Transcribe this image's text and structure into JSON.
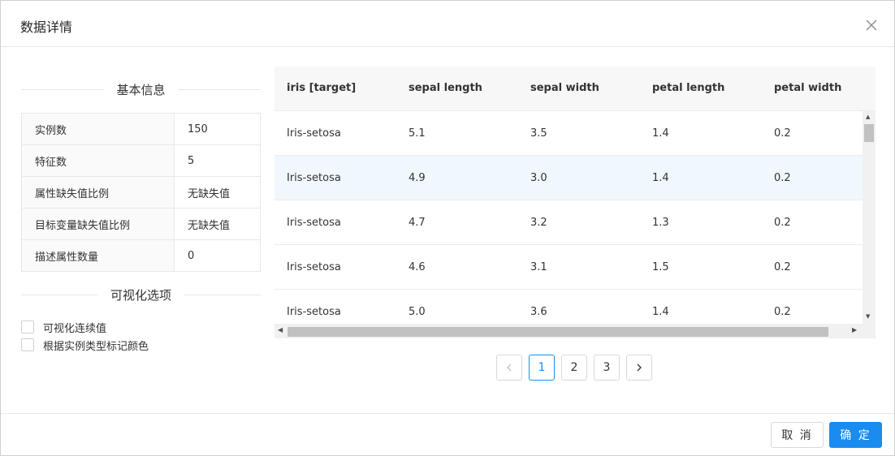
{
  "dialog": {
    "title": "数据详情",
    "close_icon": "close-icon"
  },
  "basic_info": {
    "heading": "基本信息",
    "rows": [
      {
        "label": "实例数",
        "value": "150"
      },
      {
        "label": "特征数",
        "value": "5"
      },
      {
        "label": "属性缺失值比例",
        "value": "无缺失值"
      },
      {
        "label": "目标变量缺失值比例",
        "value": "无缺失值"
      },
      {
        "label": "描述属性数量",
        "value": "0"
      }
    ]
  },
  "visual_options": {
    "heading": "可视化选项",
    "options": [
      {
        "label": "可视化连续值",
        "checked": false
      },
      {
        "label": "根据实例类型标记颜色",
        "checked": false
      }
    ]
  },
  "table": {
    "columns": [
      "iris [target]",
      "sepal length",
      "sepal width",
      "petal length",
      "petal width"
    ],
    "rows": [
      [
        "Iris-setosa",
        "5.1",
        "3.5",
        "1.4",
        "0.2"
      ],
      [
        "Iris-setosa",
        "4.9",
        "3.0",
        "1.4",
        "0.2"
      ],
      [
        "Iris-setosa",
        "4.7",
        "3.2",
        "1.3",
        "0.2"
      ],
      [
        "Iris-setosa",
        "4.6",
        "3.1",
        "1.5",
        "0.2"
      ],
      [
        "Iris-setosa",
        "5.0",
        "3.6",
        "1.4",
        "0.2"
      ]
    ],
    "highlighted_row": 1
  },
  "pagination": {
    "pages": [
      "1",
      "2",
      "3"
    ],
    "current": "1",
    "prev_icon": "chevron-left-icon",
    "next_icon": "chevron-right-icon"
  },
  "footer": {
    "cancel_label": "取 消",
    "ok_label": "确 定"
  },
  "colors": {
    "accent": "#1a8cf0",
    "row_highlight": "#f0f7fd"
  }
}
